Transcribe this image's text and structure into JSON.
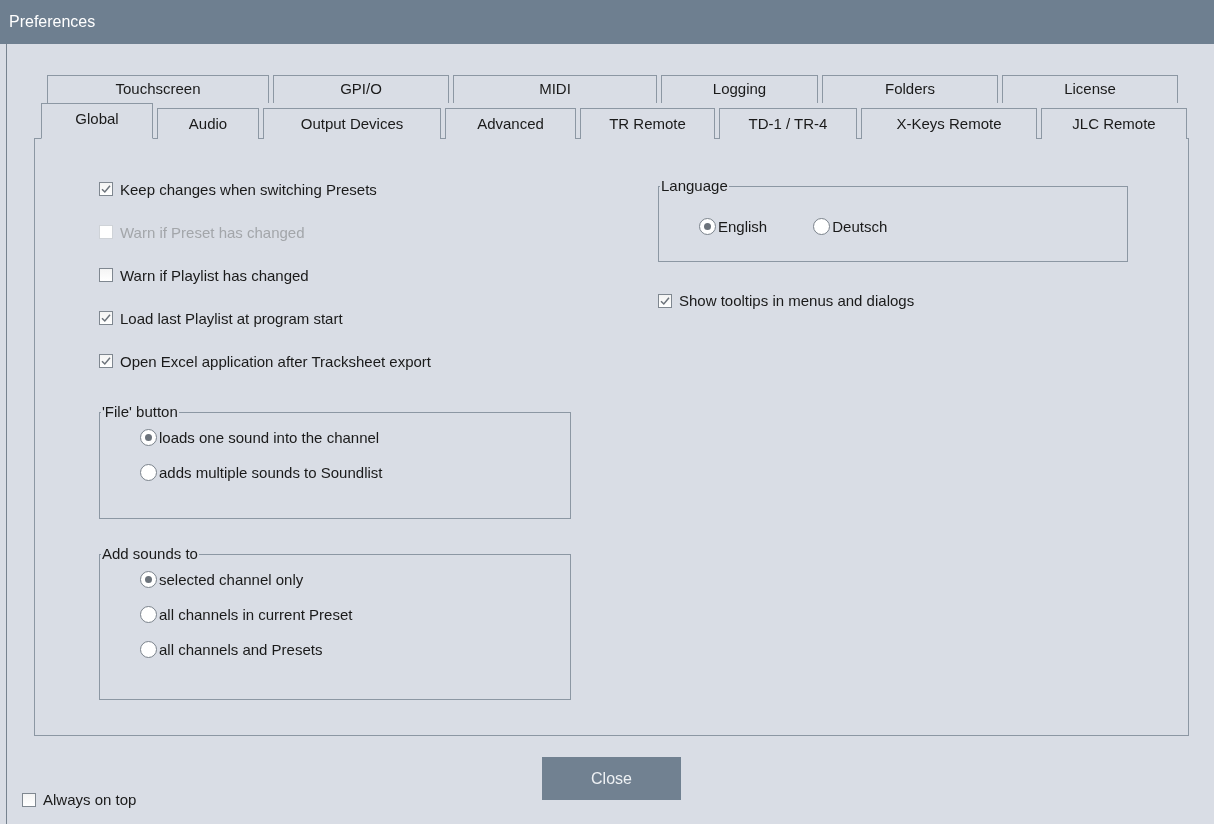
{
  "window": {
    "title": "Preferences"
  },
  "tabs": {
    "back_row": [
      {
        "label": "Touchscreen",
        "selected": false
      },
      {
        "label": "GPI/O",
        "selected": false
      },
      {
        "label": "MIDI",
        "selected": false
      },
      {
        "label": "Logging",
        "selected": false
      },
      {
        "label": "Folders",
        "selected": false
      },
      {
        "label": "License",
        "selected": false
      }
    ],
    "front_row": [
      {
        "label": "Global",
        "selected": true
      },
      {
        "label": "Audio",
        "selected": false
      },
      {
        "label": "Output Devices",
        "selected": false
      },
      {
        "label": "Advanced",
        "selected": false
      },
      {
        "label": "TR Remote",
        "selected": false
      },
      {
        "label": "TD-1 / TR-4",
        "selected": false
      },
      {
        "label": "X-Keys Remote",
        "selected": false
      },
      {
        "label": "JLC Remote",
        "selected": false
      }
    ]
  },
  "global": {
    "options": [
      {
        "label": "Keep changes when switching Presets",
        "checked": true,
        "disabled": false
      },
      {
        "label": "Warn if Preset has changed",
        "checked": false,
        "disabled": true
      },
      {
        "label": "Warn if Playlist has changed",
        "checked": false,
        "disabled": false
      },
      {
        "label": "Load last Playlist at program start",
        "checked": true,
        "disabled": false
      },
      {
        "label": "Open Excel application after Tracksheet export",
        "checked": true,
        "disabled": false
      }
    ],
    "file_button": {
      "legend": "'File' button",
      "options": [
        {
          "label": "loads one sound into the channel",
          "selected": true
        },
        {
          "label": "adds multiple sounds to Soundlist",
          "selected": false
        }
      ]
    },
    "add_sounds_to": {
      "legend": "Add sounds to",
      "options": [
        {
          "label": "selected channel only",
          "selected": true
        },
        {
          "label": "all channels in current Preset",
          "selected": false
        },
        {
          "label": "all channels and Presets",
          "selected": false
        }
      ]
    },
    "language": {
      "legend": "Language",
      "options": [
        {
          "label": "English",
          "selected": true
        },
        {
          "label": "Deutsch",
          "selected": false
        }
      ]
    },
    "show_tooltips": {
      "label": "Show tooltips in menus and dialogs",
      "checked": true,
      "disabled": false
    }
  },
  "close_button": "Close",
  "always_on_top": {
    "label": "Always on top",
    "checked": false,
    "disabled": false
  }
}
